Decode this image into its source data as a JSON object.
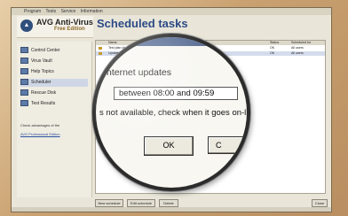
{
  "window": {
    "menu": [
      "Program",
      "Tests",
      "Service",
      "Information"
    ]
  },
  "brand": {
    "name": "AVG Anti-Virus",
    "edition": "Free Edition"
  },
  "page": {
    "title": "Scheduled tasks"
  },
  "sidebar": {
    "items": [
      {
        "label": "Control Center"
      },
      {
        "label": "Virus Vault"
      },
      {
        "label": "Help Topics"
      },
      {
        "label": "Scheduler"
      },
      {
        "label": "Rescue Disk"
      },
      {
        "label": "Test Results"
      }
    ],
    "note": "Check advantages of the",
    "link": "AVG Professional Edition"
  },
  "table": {
    "headers": [
      "Name",
      "Status",
      "Scheduled for"
    ],
    "rows": [
      {
        "name": "Test plan ch...",
        "status": "OK",
        "schedule": "All users"
      },
      {
        "name": "Update plan ... between 08:00 and 09:59",
        "status": "OK",
        "schedule": "All users"
      }
    ]
  },
  "buttons": {
    "new_schedule": "New schedule",
    "edit_schedule": "Edit schedule",
    "delete": "Delete",
    "close": "Close"
  },
  "dialog": {
    "heading": "nternet updates",
    "time_value": "between 08:00 and 09:59",
    "note": "s not available, check when it goes on-lin",
    "ok_label": "OK",
    "cancel_label": "C"
  },
  "colors": {
    "title": "#2c4a86",
    "background": "#caa57a",
    "lens_border": "#2b2b2b"
  }
}
